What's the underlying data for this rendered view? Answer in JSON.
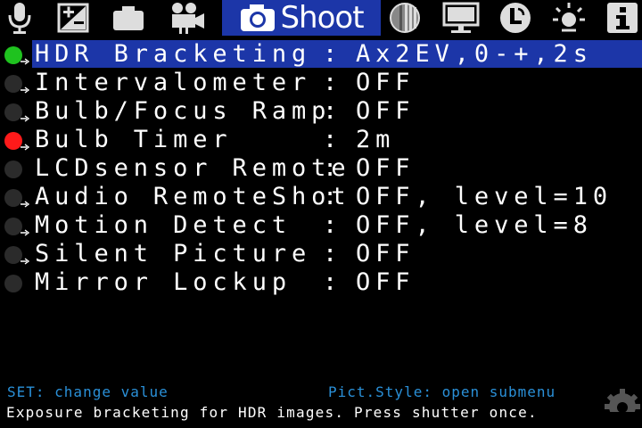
{
  "tabs": [
    {
      "icon": "microphone-icon"
    },
    {
      "icon": "exposure-icon"
    },
    {
      "icon": "camera-body-icon"
    },
    {
      "icon": "movie-camera-icon"
    },
    {
      "icon": "camera-icon",
      "label": "Shoot",
      "active": true
    },
    {
      "icon": "focus-circle-icon"
    },
    {
      "icon": "display-icon"
    },
    {
      "icon": "custom-l-icon"
    },
    {
      "icon": "brightness-icon"
    },
    {
      "icon": "info-icon"
    }
  ],
  "menu": {
    "items": [
      {
        "name": "HDR Bracketing",
        "value": "Ax2EV,0-+,2s",
        "indicator": "#1fc21f",
        "submenu": true,
        "selected": true
      },
      {
        "name": "Intervalometer",
        "value": "OFF",
        "indicator": "#2b2b2b",
        "submenu": true
      },
      {
        "name": "Bulb/Focus Ramp",
        "value": "OFF",
        "indicator": "#2b2b2b",
        "submenu": true
      },
      {
        "name": "Bulb Timer",
        "value": "2m",
        "indicator": "#ff1a1a",
        "submenu": true
      },
      {
        "name": "LCDsensor Remote",
        "value": "OFF",
        "indicator": "#2b2b2b",
        "submenu": false
      },
      {
        "name": "Audio RemoteShot",
        "value": "OFF, level=10",
        "indicator": "#2b2b2b",
        "submenu": true
      },
      {
        "name": "Motion Detect",
        "value": "OFF, level=8",
        "indicator": "#2b2b2b",
        "submenu": true
      },
      {
        "name": "Silent Picture",
        "value": "OFF",
        "indicator": "#2b2b2b",
        "submenu": true
      },
      {
        "name": "Mirror Lockup",
        "value": "OFF",
        "indicator": "#2b2b2b",
        "submenu": false
      }
    ],
    "separator": ":"
  },
  "help": {
    "set_hint": "SET: change value",
    "picstyle_hint": "Pict.Style: open submenu",
    "description": "Exposure bracketing for HDR images. Press shutter once."
  },
  "colors": {
    "accent": "#1c36a8",
    "help_text": "#2a90d8"
  }
}
